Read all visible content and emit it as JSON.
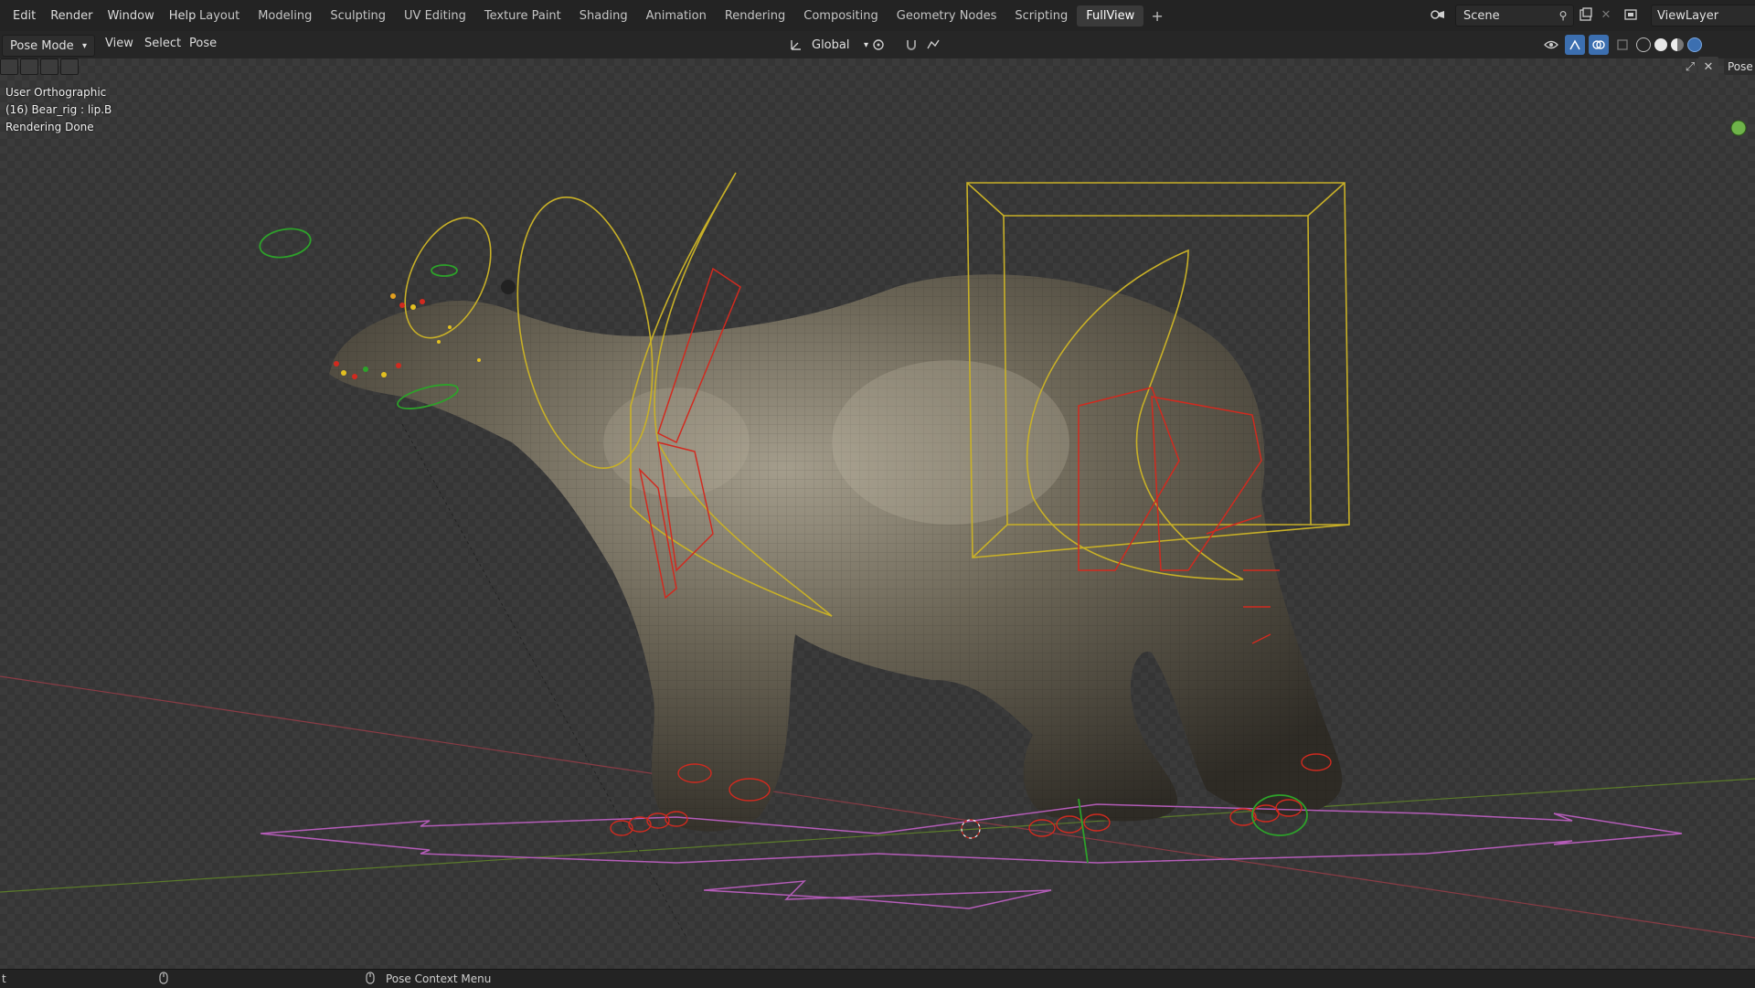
{
  "menubar": {
    "items": [
      "Edit",
      "Render",
      "Window",
      "Help"
    ]
  },
  "workspaces": {
    "tabs": [
      "Layout",
      "Modeling",
      "Sculpting",
      "UV Editing",
      "Texture Paint",
      "Shading",
      "Animation",
      "Rendering",
      "Compositing",
      "Geometry Nodes",
      "Scripting",
      "FullView"
    ],
    "active": "FullView",
    "add_label": "+"
  },
  "scene": {
    "name": "Scene"
  },
  "view_layer": {
    "name": "ViewLayer"
  },
  "header": {
    "mode": "Pose Mode",
    "menus": [
      "View",
      "Select",
      "Pose"
    ],
    "orientation": "Global",
    "right_label": "Pose"
  },
  "viewport": {
    "view_name": "User Orthographic",
    "object_info": "(16) Bear_rig : lip.B",
    "status": "Rendering Done"
  },
  "statusbar": {
    "left_fragment": "t",
    "context_menu": "Pose Context Menu"
  },
  "colors": {
    "active_tab": "#3a3a3a",
    "bone_red": "#d12a1f",
    "bone_yellow": "#c8b027",
    "bone_green": "#2da12a",
    "root_purple": "#b45cb8",
    "grid_red": "#8a3b45",
    "grid_green": "#5a7a2a"
  },
  "icons": [
    "cursor-icon",
    "transform-pivot-icon",
    "snap-icon",
    "proportional-icon",
    "pin-icon",
    "scene-icon",
    "new-scene-icon",
    "close-icon",
    "viewlayer-icon",
    "gizmo-icon",
    "overlay-icon",
    "xray-icon",
    "wireframe-shading-icon",
    "solid-shading-icon",
    "material-shading-icon",
    "rendered-shading-icon",
    "mouse-icon"
  ]
}
